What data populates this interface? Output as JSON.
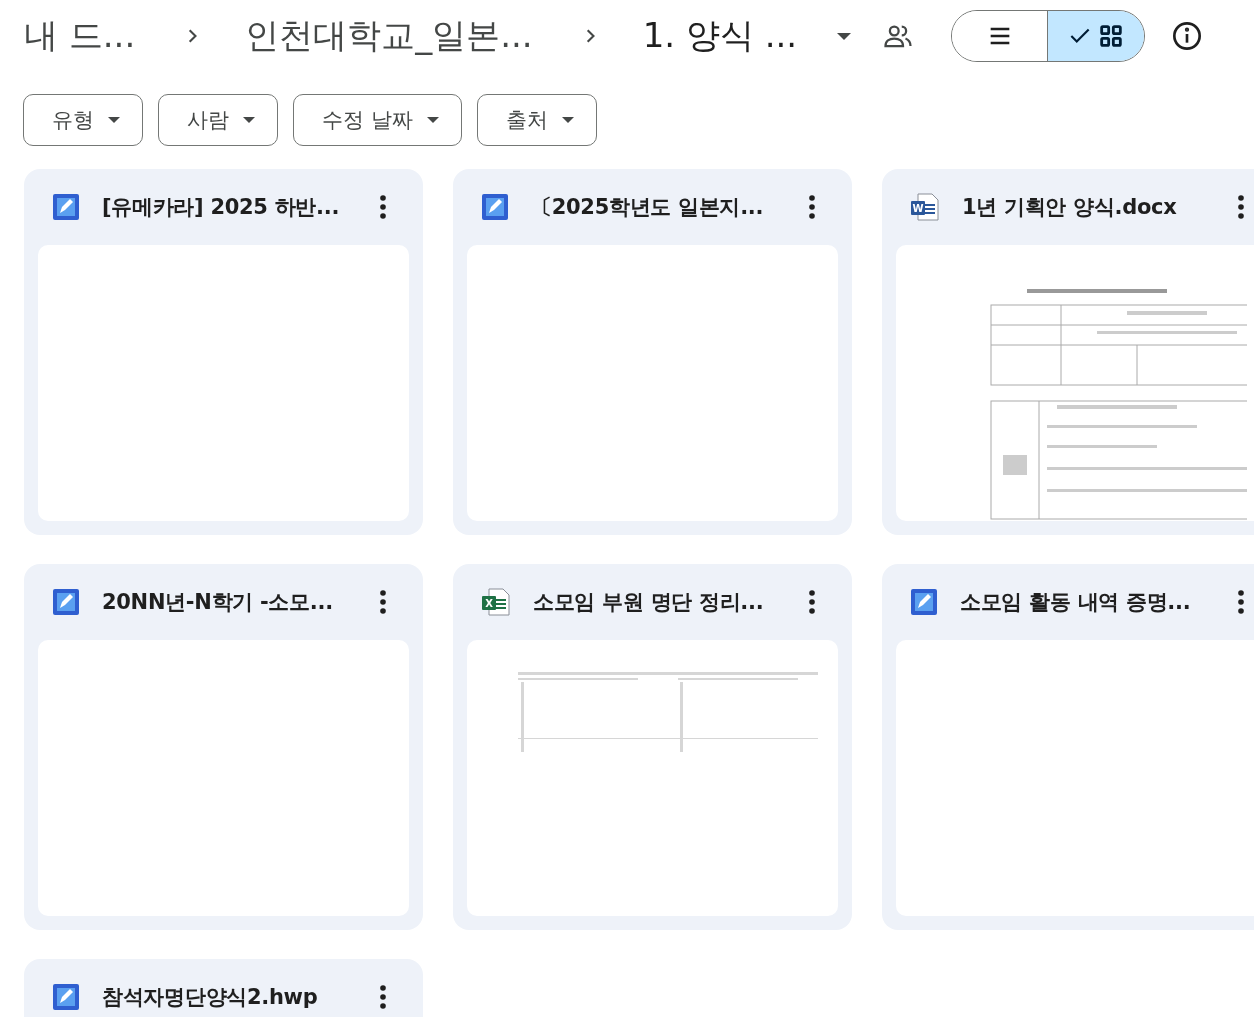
{
  "breadcrumbs": [
    {
      "label": "내 드...",
      "current": false
    },
    {
      "label": "인천대학교_일본...",
      "current": false
    },
    {
      "label": "1. 양식 ...",
      "current": true
    }
  ],
  "view_toggle": [
    {
      "kind": "list",
      "selected": false
    },
    {
      "kind": "grid",
      "selected": true
    }
  ],
  "filters": [
    {
      "label": "유형"
    },
    {
      "label": "사람"
    },
    {
      "label": "수정 날짜"
    },
    {
      "label": "출처"
    }
  ],
  "files": [
    {
      "name": "[유메카라] 2025 하반...",
      "kind": "hwp"
    },
    {
      "name": "〔2025학년도 일본지...",
      "kind": "hwp"
    },
    {
      "name": "1년 기획안 양식.docx",
      "kind": "word",
      "badge": "W",
      "preview": {
        "kind": "document"
      }
    },
    {
      "name": "20NN년-N학기 -소모...",
      "kind": "hwp"
    },
    {
      "name": "소모임 부원 명단 정리...",
      "kind": "excel",
      "badge": "X",
      "preview": {
        "kind": "spreadsheet"
      }
    },
    {
      "name": "소모임 활동 내역 증명...",
      "kind": "hwp"
    },
    {
      "name": "참석자명단양식2.hwp",
      "kind": "hwp"
    }
  ]
}
